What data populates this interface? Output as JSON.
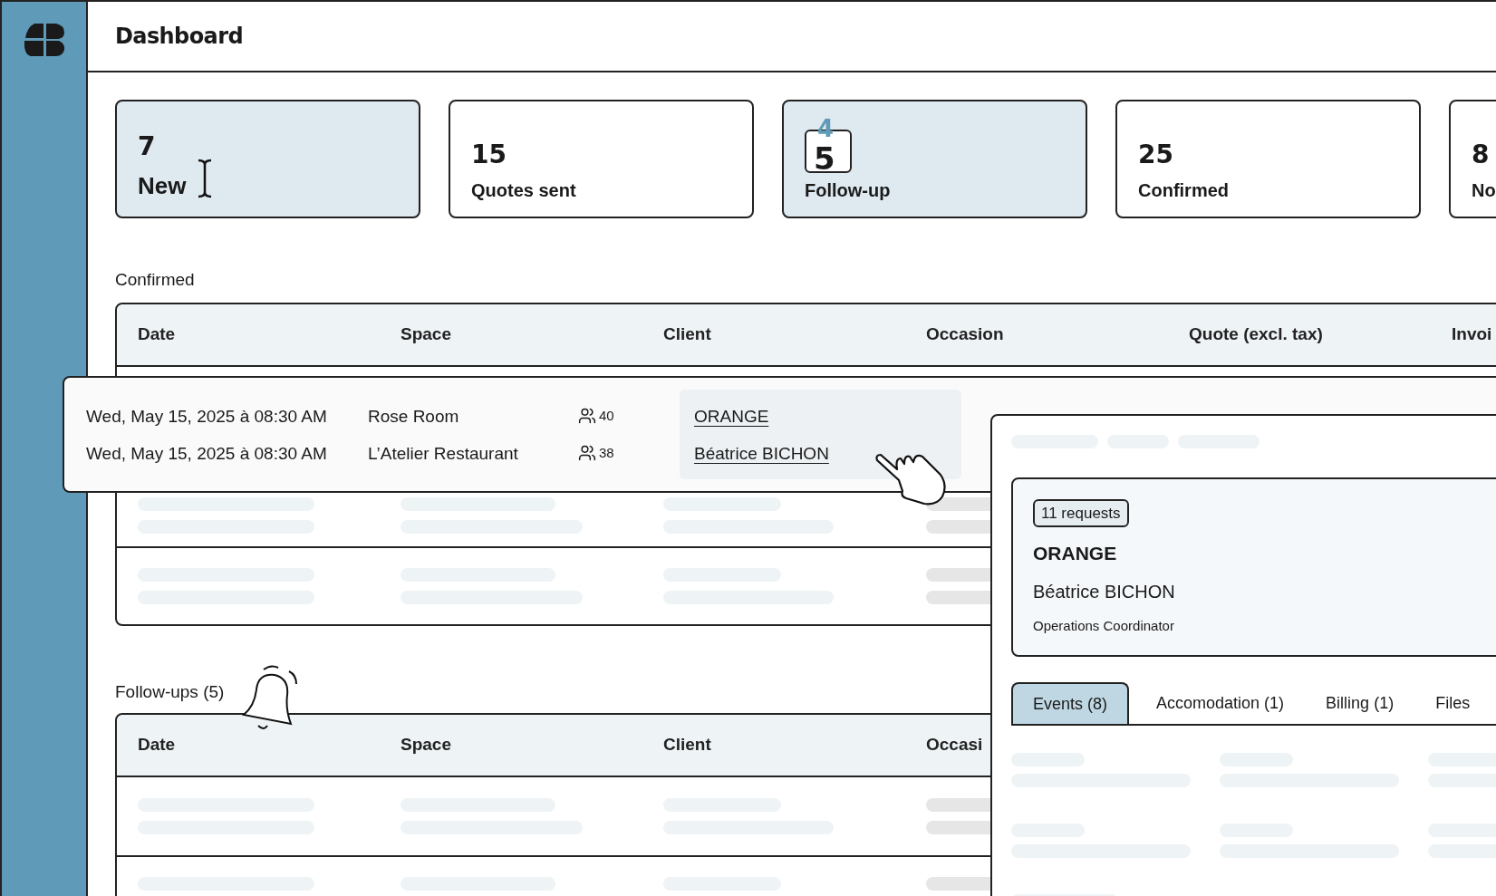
{
  "header": {
    "title": "Dashboard"
  },
  "stat_cards": [
    {
      "kind": "number",
      "value": "7",
      "label": "New",
      "selected": true
    },
    {
      "kind": "number",
      "value": "15",
      "label": "Quotes sent",
      "selected": false
    },
    {
      "kind": "flip",
      "previous_value": "4",
      "value": "5",
      "label": "Follow-up",
      "selected": true
    },
    {
      "kind": "number",
      "value": "25",
      "label": "Confirmed",
      "selected": false
    },
    {
      "kind": "number",
      "value": "8",
      "label": "No",
      "selected": false
    }
  ],
  "confirmed_table": {
    "title": "Confirmed",
    "columns": [
      "Date",
      "Space",
      "Client",
      "Occasion",
      "Quote (excl. tax)",
      "Invoi"
    ]
  },
  "expanded_row": {
    "rows": [
      {
        "date": "Wed, May 15, 2025 à 08:30 AM",
        "space": "Rose Room",
        "guests": "40",
        "client": "ORANGE"
      },
      {
        "date": "Wed, May 15, 2025 à 08:30 AM",
        "space": "L’Atelier Restaurant",
        "guests": "38",
        "client": "Béatrice BICHON"
      }
    ]
  },
  "followups_table": {
    "title": "Follow-ups (5)",
    "columns": [
      "Date",
      "Space",
      "Client",
      "Occasi"
    ]
  },
  "client_panel": {
    "badge": "11 requests",
    "company": "ORANGE",
    "contact": "Béatrice BICHON",
    "role": "Operations Coordinator",
    "tabs": [
      {
        "label": "Events (8)",
        "selected": true
      },
      {
        "label": "Accomodation (1)",
        "selected": false
      },
      {
        "label": "Billing (1)",
        "selected": false
      },
      {
        "label": "Files",
        "selected": false
      }
    ]
  }
}
